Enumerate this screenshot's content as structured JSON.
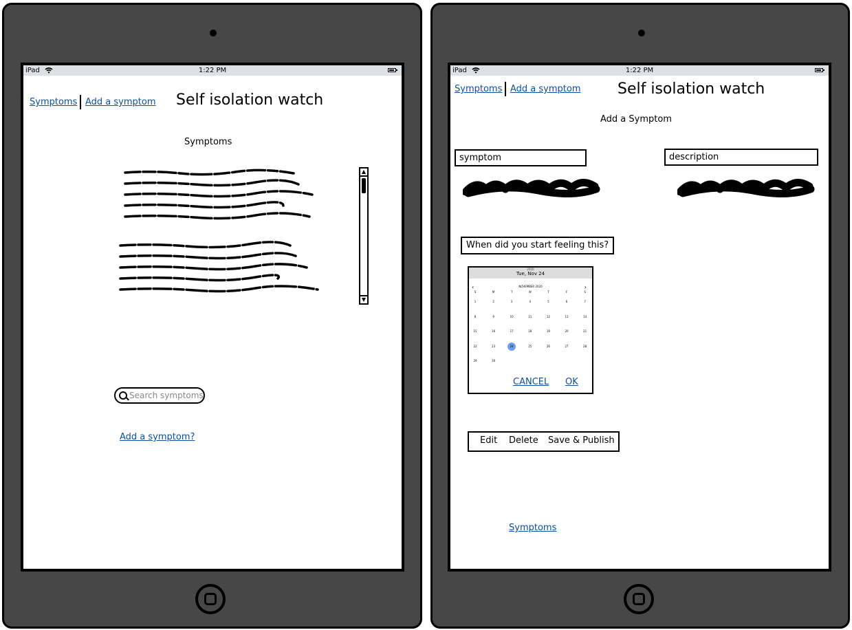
{
  "left_screen": {
    "status": {
      "device": "iPad",
      "time": "1:22 PM"
    },
    "nav": {
      "symptoms_link": "Symptoms",
      "add_symptom_link": "Add a symptom"
    },
    "app_title": "Self isolation watch",
    "section_title": "Symptoms",
    "search": {
      "placeholder": "Search symptoms"
    },
    "add_link": "Add a symptom?"
  },
  "right_screen": {
    "status": {
      "device": "iPad",
      "time": "1:22 PM"
    },
    "nav": {
      "symptoms_link": "Symptoms",
      "add_symptom_link": "Add a symptom"
    },
    "app_title": "Self isolation watch",
    "section_title": "Add a Symptom",
    "symptom_field": {
      "value": "symptom"
    },
    "description_field": {
      "value": "description"
    },
    "when_label": "When did you start feeling this?",
    "datepicker": {
      "year": "2020",
      "selected_date": "Tue, Nov 24",
      "month": "NOVEMBER 2020",
      "weekdays": [
        "S",
        "M",
        "T",
        "W",
        "T",
        "F",
        "S"
      ],
      "weeks": [
        [
          "1",
          "2",
          "3",
          "4",
          "5",
          "6",
          "7"
        ],
        [
          "8",
          "9",
          "10",
          "11",
          "12",
          "13",
          "14"
        ],
        [
          "15",
          "16",
          "17",
          "18",
          "19",
          "20",
          "21"
        ],
        [
          "22",
          "23",
          "24",
          "25",
          "26",
          "27",
          "28"
        ],
        [
          "29",
          "30",
          "",
          "",
          "",
          "",
          ""
        ]
      ],
      "selected_day": "24",
      "cancel_label": "CANCEL",
      "ok_label": "OK",
      "prev_icon": "chevron-left-icon",
      "next_icon": "chevron-right-icon"
    },
    "actions": {
      "edit": "Edit",
      "delete": "Delete",
      "save_publish": "Save & Publish"
    },
    "bottom_link": "Symptoms"
  },
  "colors": {
    "device_frame": "#474747",
    "status_bar": "#dde1e3",
    "link": "#0b4fa0",
    "selected_day": "#6e9ee6"
  }
}
